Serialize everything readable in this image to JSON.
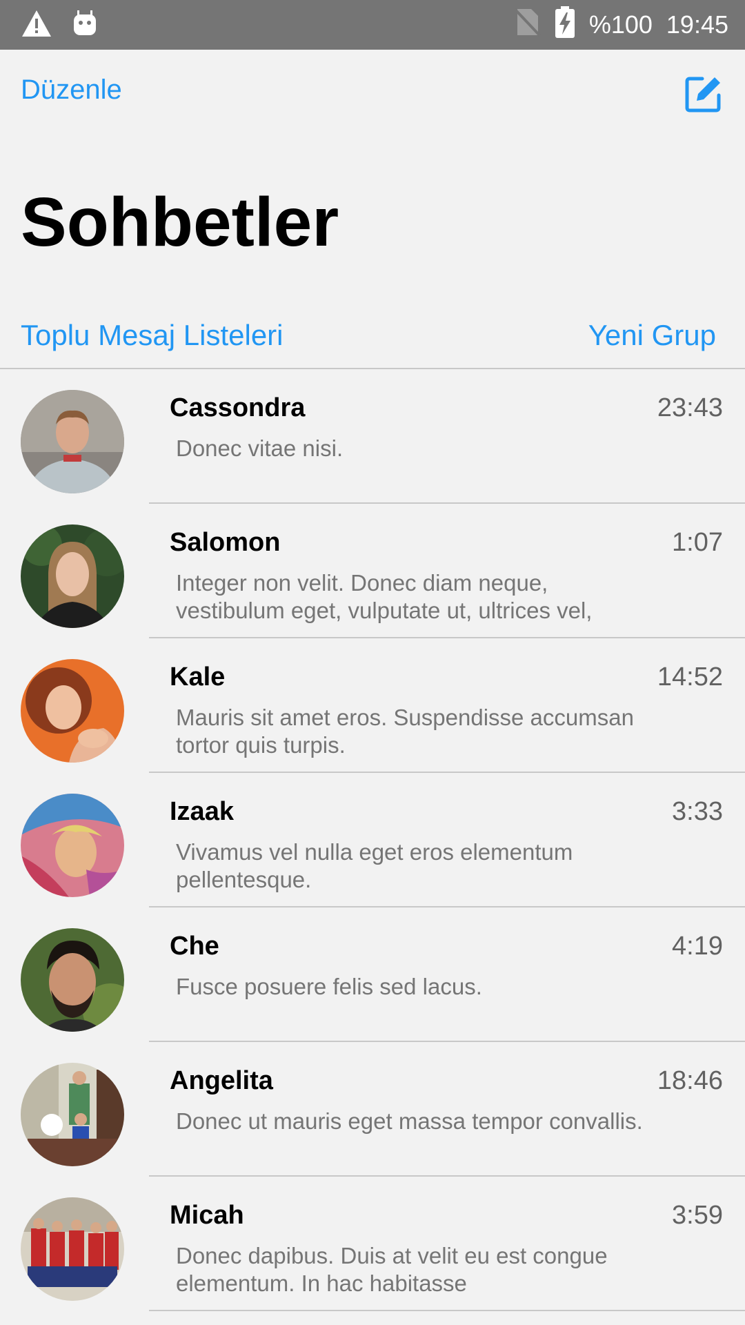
{
  "status_bar": {
    "battery": "%100",
    "time": "19:45",
    "icons": [
      "warning-icon",
      "android-icon",
      "no-sim-icon",
      "battery-charging-icon"
    ]
  },
  "header": {
    "edit_label": "Düzenle",
    "compose_icon": "compose-icon",
    "title": "Sohbetler",
    "broadcast_label": "Toplu Mesaj Listeleri",
    "new_group_label": "Yeni Grup"
  },
  "colors": {
    "accent": "#2196f3",
    "status_bar": "#757575",
    "background": "#f2f2f2"
  },
  "chats": [
    {
      "name": "Cassondra",
      "time": "23:43",
      "preview": "Donec vitae nisi."
    },
    {
      "name": "Salomon",
      "time": "1:07",
      "preview": "Integer non velit. Donec diam neque, vestibulum eget, vulputate ut, ultrices vel,"
    },
    {
      "name": "Kale",
      "time": "14:52",
      "preview": "Mauris sit amet eros. Suspendisse accumsan tortor quis turpis."
    },
    {
      "name": "Izaak",
      "time": "3:33",
      "preview": "Vivamus vel nulla eget eros elementum pellentesque."
    },
    {
      "name": "Che",
      "time": "4:19",
      "preview": "Fusce posuere felis sed lacus."
    },
    {
      "name": "Angelita",
      "time": "18:46",
      "preview": "Donec ut mauris eget massa tempor convallis."
    },
    {
      "name": "Micah",
      "time": "3:59",
      "preview": "Donec dapibus. Duis at velit eu est congue elementum. In hac habitasse"
    }
  ]
}
